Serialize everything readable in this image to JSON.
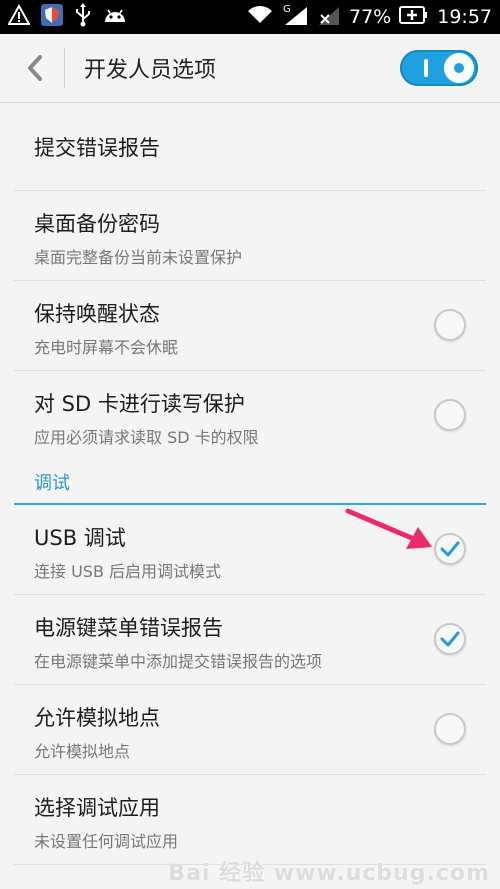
{
  "status_bar": {
    "battery_percent": "77%",
    "time": "19:57",
    "network_label": "G"
  },
  "header": {
    "title": "开发人员选项",
    "developer_options_enabled": true
  },
  "settings": {
    "bug_report": {
      "title": "提交错误报告"
    },
    "desktop_backup_password": {
      "title": "桌面备份密码",
      "summary": "桌面完整备份当前未设置保护"
    },
    "stay_awake": {
      "title": "保持唤醒状态",
      "summary": "充电时屏幕不会休眠",
      "checked": false
    },
    "protect_sd": {
      "title": "对 SD 卡进行读写保护",
      "summary": "应用必须请求读取 SD 卡的权限",
      "checked": false
    },
    "debug_section_label": "调试",
    "usb_debugging": {
      "title": "USB 调试",
      "summary": "连接 USB 后启用调试模式",
      "checked": true
    },
    "power_menu_bug_report": {
      "title": "电源键菜单错误报告",
      "summary": "在电源键菜单中添加提交错误报告的选项",
      "checked": true
    },
    "mock_locations": {
      "title": "允许模拟地点",
      "summary": "允许模拟地点",
      "checked": false
    },
    "select_debug_app": {
      "title": "选择调试应用",
      "summary": "未设置任何调试应用"
    }
  },
  "watermark": "Bai 经验  www.ucbug.com"
}
